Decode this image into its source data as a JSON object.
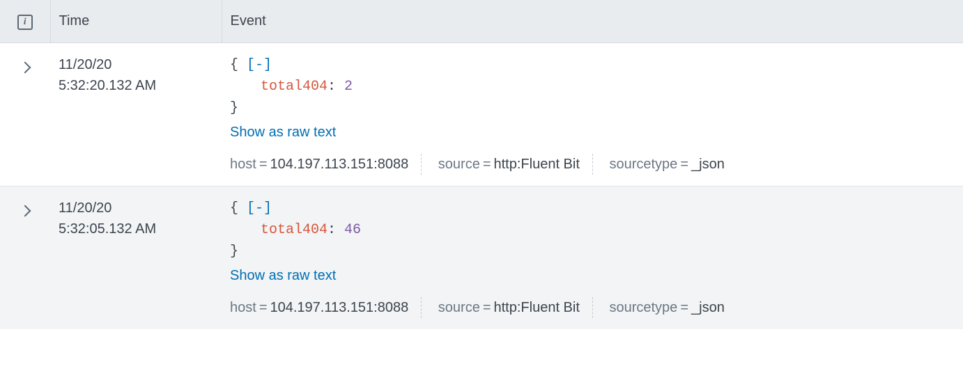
{
  "header": {
    "info_icon_label": "i",
    "time_col": "Time",
    "event_col": "Event"
  },
  "json_syntax": {
    "open": "{",
    "close": "}",
    "collapse": "[-]",
    "colon": ":"
  },
  "labels": {
    "show_raw": "Show as raw text",
    "meta_host": "host",
    "meta_source": "source",
    "meta_sourcetype": "sourcetype",
    "eq": "="
  },
  "rows": [
    {
      "date": "11/20/20",
      "time": "5:32:20.132 AM",
      "field_key": "total404",
      "field_val": "2",
      "host": "104.197.113.151:8088",
      "source": "http:Fluent Bit",
      "sourcetype": "_json"
    },
    {
      "date": "11/20/20",
      "time": "5:32:05.132 AM",
      "field_key": "total404",
      "field_val": "46",
      "host": "104.197.113.151:8088",
      "source": "http:Fluent Bit",
      "sourcetype": "_json"
    }
  ]
}
